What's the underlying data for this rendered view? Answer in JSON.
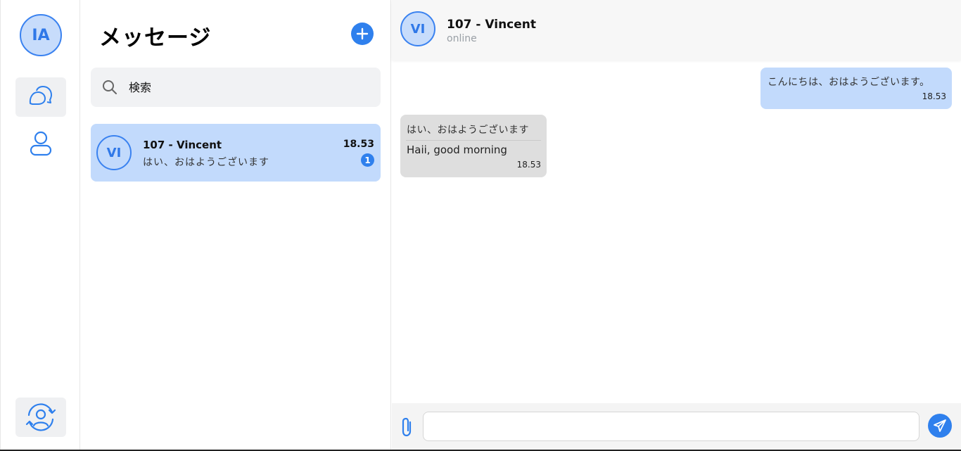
{
  "colors": {
    "accent": "#2f80ed",
    "selected_bg": "#c2dafc",
    "incoming_bg": "#dedede"
  },
  "rail": {
    "me_initials": "IA",
    "items": [
      {
        "icon": "chat-bubbles-icon",
        "active": true
      },
      {
        "icon": "user-icon",
        "active": false
      }
    ],
    "bottom_icon": "switch-account-icon"
  },
  "list": {
    "title": "メッセージ",
    "new_icon": "plus-icon",
    "search": {
      "placeholder": "検索",
      "value": ""
    },
    "conversations": [
      {
        "initials": "VI",
        "name": "107 - Vincent",
        "preview": "はい、おはようございます",
        "time": "18.53",
        "unread": "1",
        "selected": true
      }
    ]
  },
  "chat": {
    "contact": {
      "initials": "VI",
      "name": "107 - Vincent",
      "status": "online"
    },
    "messages": [
      {
        "direction": "out",
        "text": "こんにちは、おはようございます。",
        "time": "18.53"
      },
      {
        "direction": "in",
        "text": "はい、おはようございます",
        "translation": "Haii, good morning",
        "time": "18.53"
      }
    ],
    "composer": {
      "placeholder": "",
      "value": "",
      "attach_icon": "paperclip-icon",
      "send_icon": "send-icon"
    }
  }
}
